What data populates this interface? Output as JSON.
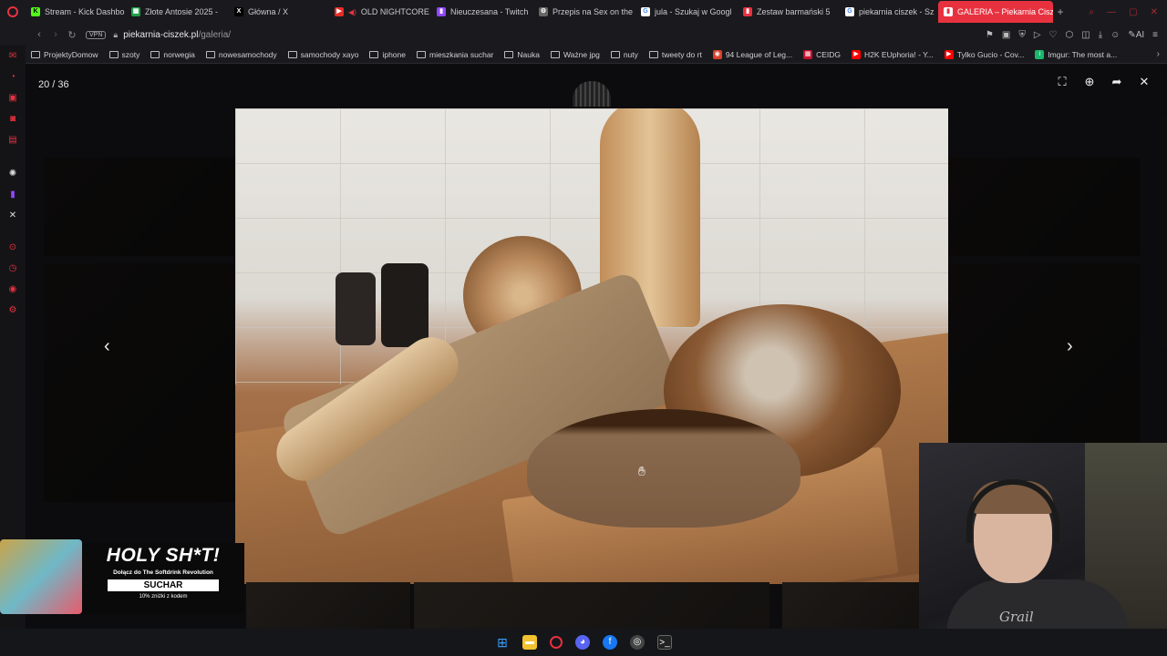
{
  "tabs": [
    {
      "label": "Stream - Kick Dashbo",
      "color": "#53fc18",
      "glyph": "K"
    },
    {
      "label": "Złote Antosie 2025 -",
      "color": "#1e9e4a",
      "glyph": "▦"
    },
    {
      "label": "Główna / X",
      "color": "#000000",
      "glyph": "X"
    },
    {
      "label": "OLD NIGHTCORE",
      "color": "#e52d27",
      "glyph": "▶"
    },
    {
      "label": "Nieuczesana - Twitch",
      "color": "#9146ff",
      "glyph": "▮"
    },
    {
      "label": "Przepis na Sex on the",
      "color": "#666666",
      "glyph": "⚙"
    },
    {
      "label": "jula - Szukaj w Googl",
      "color": "#4285f4",
      "glyph": "G"
    },
    {
      "label": "Zestaw barmański 5",
      "color": "#e8313f",
      "glyph": "▮"
    },
    {
      "label": "piekarnia ciszek - Sz",
      "color": "#4285f4",
      "glyph": "G"
    },
    {
      "label": "GALERIA – Piekarnia Cisz",
      "color": "#e8313f",
      "glyph": "▮"
    }
  ],
  "address": {
    "domain": "piekarnia-ciszek.pl",
    "path": "/galeria/",
    "vpn": "VPN"
  },
  "bookmarks": [
    {
      "label": "ProjektyDomow",
      "kind": "folder"
    },
    {
      "label": "szoty",
      "kind": "folder"
    },
    {
      "label": "norwegia",
      "kind": "folder"
    },
    {
      "label": "nowesamochody",
      "kind": "folder"
    },
    {
      "label": "samochody xayo",
      "kind": "folder"
    },
    {
      "label": "iphone",
      "kind": "folder"
    },
    {
      "label": "mieszkania suchar",
      "kind": "folder"
    },
    {
      "label": "Nauka",
      "kind": "folder"
    },
    {
      "label": "Ważne jpg",
      "kind": "folder"
    },
    {
      "label": "nuty",
      "kind": "folder"
    },
    {
      "label": "tweety do rt",
      "kind": "folder"
    },
    {
      "label": "94 League of Leg...",
      "kind": "site",
      "color": "#d93f2b"
    },
    {
      "label": "CEIDG",
      "kind": "site",
      "color": "#c8102e"
    },
    {
      "label": "H2K EUphoria! - Y...",
      "kind": "site",
      "color": "#ff0000"
    },
    {
      "label": "Tylko Gucio - Cov...",
      "kind": "site",
      "color": "#ff0000"
    },
    {
      "label": "Imgur: The most a...",
      "kind": "site",
      "color": "#1bb76e"
    }
  ],
  "lightbox": {
    "counter": "20 / 36"
  },
  "ad": {
    "title": "HOLY SH*T!",
    "subtitle": "Dołącz do The Softdrink Revolution",
    "code": "SUCHAR",
    "note": "10% zniżki z kodem"
  },
  "webcam": {
    "logo_text": "Grail"
  }
}
